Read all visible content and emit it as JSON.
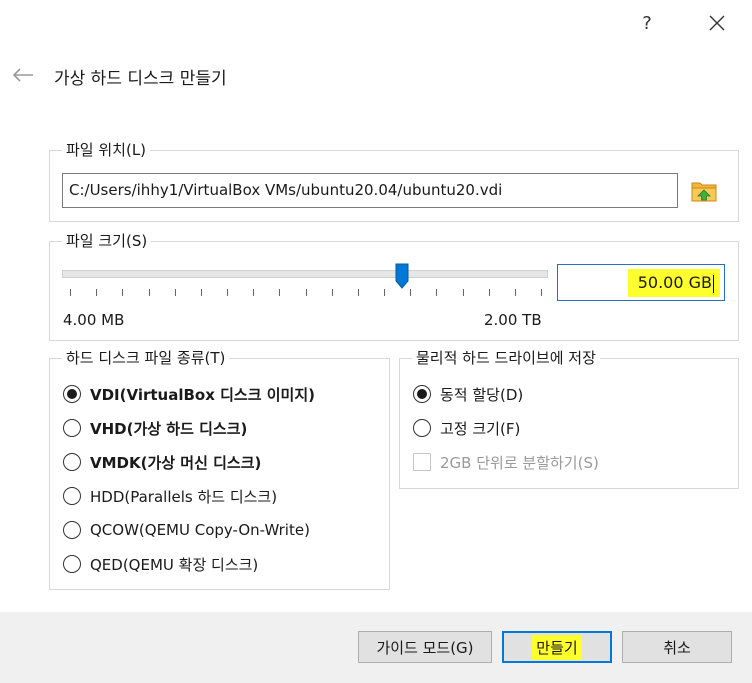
{
  "titlebar": {
    "help_label": "?",
    "close_icon": "close-icon"
  },
  "header": {
    "back_icon": "arrow-left-icon",
    "title": "가상 하드 디스크 만들기"
  },
  "file_location": {
    "group_label": "파일 위치(L)",
    "path_value": "C:/Users/ihhy1/VirtualBox VMs/ubuntu20.04/ubuntu20.vdi",
    "browse_icon": "folder-icon"
  },
  "file_size": {
    "group_label": "파일 크기(S)",
    "min_label": "4.00 MB",
    "max_label": "2.00 TB",
    "value": "50.00 GB",
    "slider_level": 0.7
  },
  "disk_type": {
    "group_label": "하드 디스크 파일 종류(T)",
    "options": [
      {
        "label": "VDI(VirtualBox 디스크 이미지)",
        "selected": true,
        "bold": true
      },
      {
        "label": "VHD(가상 하드 디스크)",
        "selected": false,
        "bold": true
      },
      {
        "label": "VMDK(가상 머신 디스크)",
        "selected": false,
        "bold": true
      },
      {
        "label": "HDD(Parallels 하드 디스크)",
        "selected": false,
        "bold": false
      },
      {
        "label": "QCOW(QEMU Copy-On-Write)",
        "selected": false,
        "bold": false
      },
      {
        "label": "QED(QEMU 확장 디스크)",
        "selected": false,
        "bold": false
      }
    ]
  },
  "storage": {
    "group_label": "물리적 하드 드라이브에 저장",
    "options": [
      {
        "label": "동적 할당(D)",
        "selected": true
      },
      {
        "label": "고정 크기(F)",
        "selected": false
      }
    ],
    "split_label": "2GB 단위로 분할하기(S)"
  },
  "footer": {
    "guided_label": "가이드 모드(G)",
    "create_label": "만들기",
    "cancel_label": "취소"
  },
  "colors": {
    "highlight": "#ffff2e",
    "accent": "#0078d7"
  }
}
